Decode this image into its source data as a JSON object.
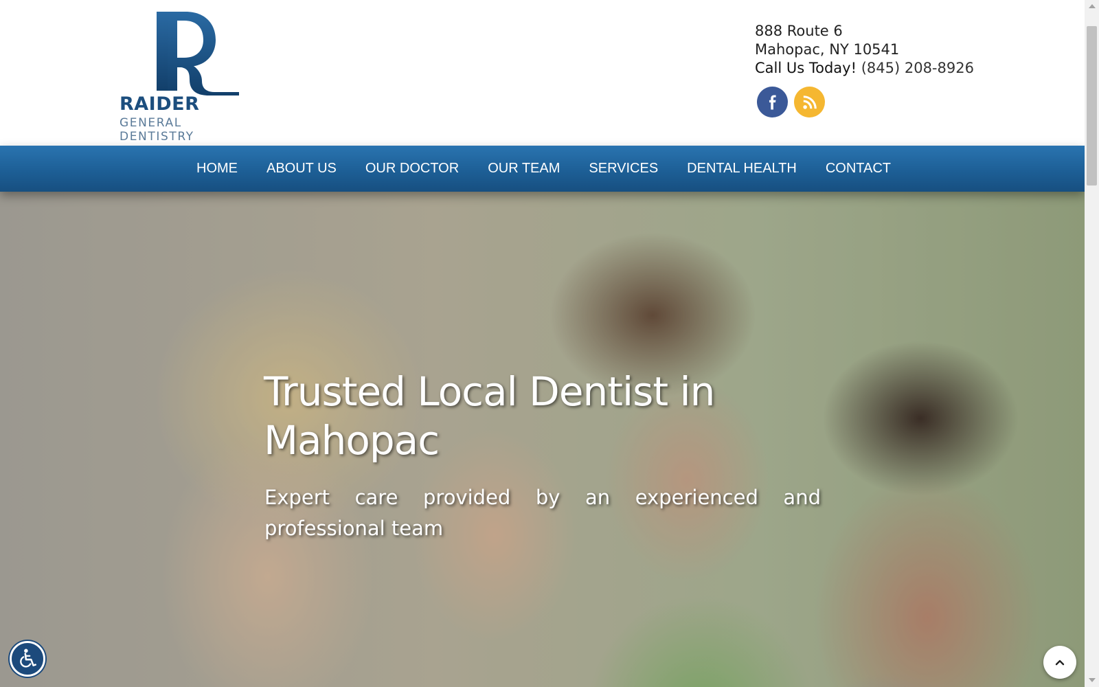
{
  "logo": {
    "name": "RAIDER",
    "tagline": "GENERAL DENTISTRY",
    "colors": {
      "primary": "#1c4e7e",
      "secondary": "#5a7a98"
    }
  },
  "contact": {
    "address_line1": "888 Route 6",
    "address_line2": "Mahopac, NY 10541",
    "call_label": "Call Us Today!",
    "phone": "(845) 208-8926"
  },
  "social": [
    {
      "icon": "facebook-icon",
      "color": "#3b5998"
    },
    {
      "icon": "rss-icon",
      "color": "#f5b731"
    }
  ],
  "nav": {
    "items": [
      "HOME",
      "ABOUT US",
      "OUR DOCTOR",
      "OUR TEAM",
      "SERVICES",
      "DENTAL HEALTH",
      "CONTACT"
    ],
    "color": "#1d5f96"
  },
  "hero": {
    "title": "Trusted Local Dentist in Mahopac",
    "subtitle": "Expert care provided by an experienced and professional team"
  },
  "floating": {
    "accessibility_icon": "wheelchair-icon",
    "back_to_top_icon": "chevron-up-icon"
  }
}
